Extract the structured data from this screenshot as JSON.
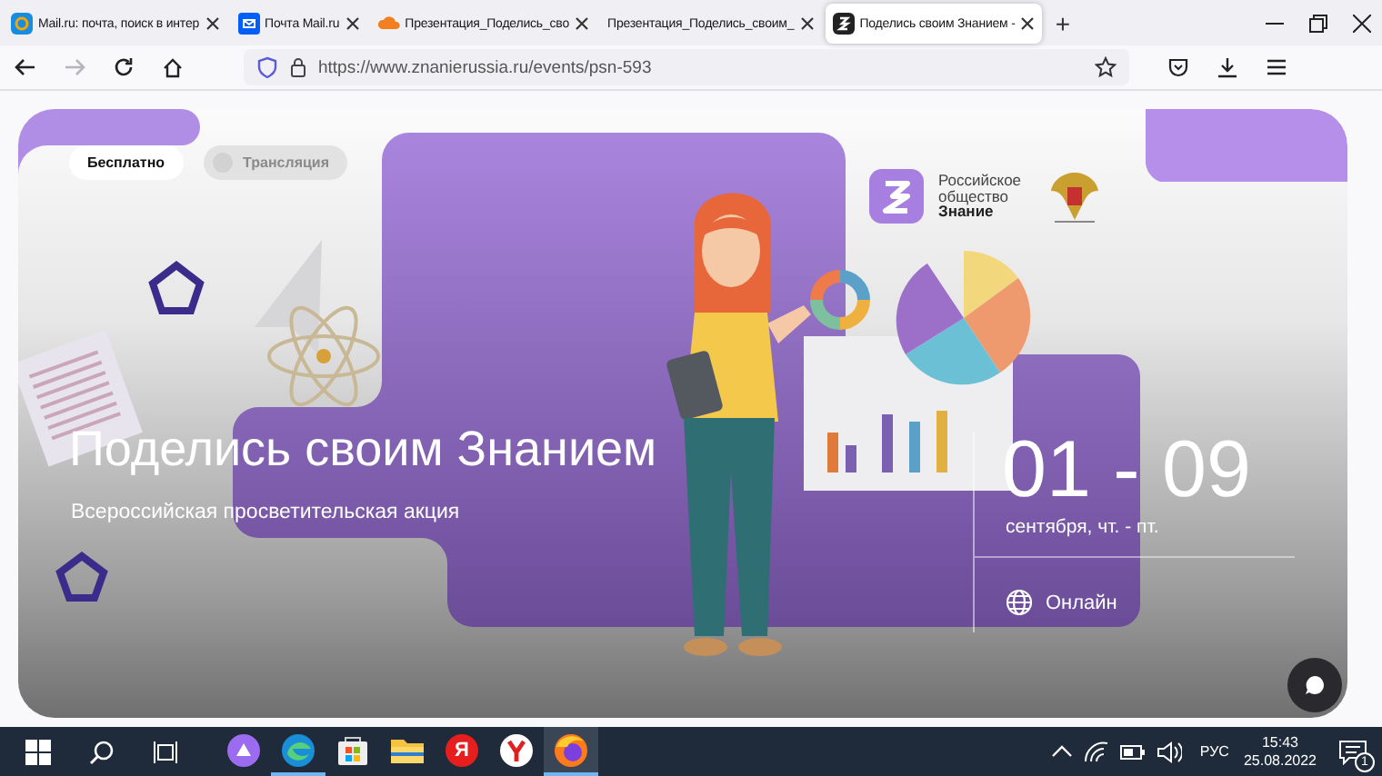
{
  "browser": {
    "tabs": [
      {
        "label": "Mail.ru: почта, поиск в интер",
        "kind": "at",
        "selected": false
      },
      {
        "label": "Почта Mail.ru",
        "kind": "envelope",
        "selected": false
      },
      {
        "label": "Презентация_Поделись_сво",
        "kind": "cloud",
        "selected": false
      },
      {
        "label": "Презентация_Поделись_своим_",
        "kind": "plain",
        "selected": false
      },
      {
        "label": "Поделись своим Знанием -",
        "kind": "znanie",
        "selected": true
      }
    ],
    "new_tab": "+",
    "nav": {
      "forward_disabled": true
    },
    "address": "https://www.znanierussia.ru/events/psn-593"
  },
  "hero": {
    "badges": [
      {
        "label": "Бесплатно",
        "active": true
      },
      {
        "label": "Трансляция",
        "active": false
      }
    ],
    "logo_lines": [
      "Российское",
      "общество",
      "Знание"
    ],
    "title": "Поделись своим Знанием",
    "subtitle": "Всероссийская просветительская акция",
    "dates": "01 - 09",
    "days": "сентября, чт. - пт.",
    "format": "Онлайн"
  },
  "taskbar": {
    "apps": [
      {
        "kind": "alice",
        "running": false,
        "selected": false
      },
      {
        "kind": "edge",
        "running": true,
        "selected": false
      },
      {
        "kind": "store",
        "running": false,
        "selected": false
      },
      {
        "kind": "folder",
        "running": false,
        "selected": false
      },
      {
        "kind": "yandex",
        "glyph": "Я",
        "running": false,
        "selected": false
      },
      {
        "kind": "ybrowser",
        "running": false,
        "selected": false
      },
      {
        "kind": "firefox",
        "running": true,
        "selected": true
      }
    ],
    "language": "РУС",
    "time": "15:43",
    "date": "25.08.2022",
    "notifications": "1"
  }
}
